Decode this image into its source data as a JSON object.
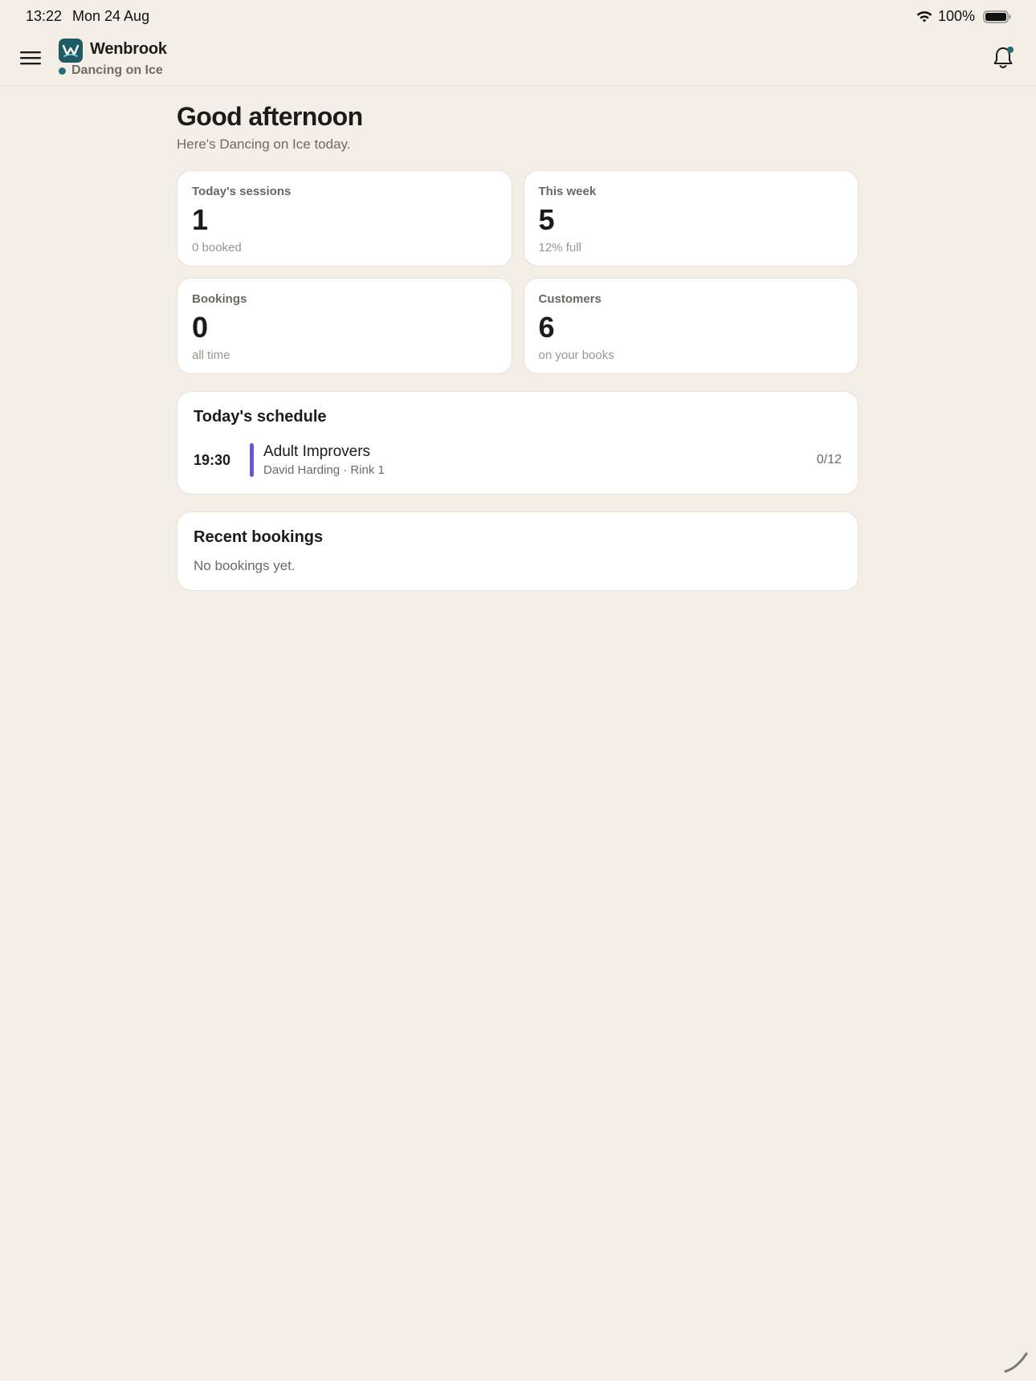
{
  "status_bar": {
    "time": "13:22",
    "date": "Mon 24 Aug",
    "battery": "100%"
  },
  "header": {
    "brand": "Wenbrook",
    "venue": "Dancing on Ice"
  },
  "greeting": {
    "title": "Good afternoon",
    "subtitle": "Here's Dancing on Ice today."
  },
  "stats": [
    {
      "label": "Today's sessions",
      "value": "1",
      "note": "0 booked"
    },
    {
      "label": "This week",
      "value": "5",
      "note": "12% full"
    },
    {
      "label": "Bookings",
      "value": "0",
      "note": "all time"
    },
    {
      "label": "Customers",
      "value": "6",
      "note": "on your books"
    }
  ],
  "schedule": {
    "title": "Today's schedule",
    "sessions": [
      {
        "time": "19:30",
        "name": "Adult Improvers",
        "meta": "David Harding · Rink 1",
        "capacity": "0/12",
        "color": "#6a56d8"
      }
    ]
  },
  "recent": {
    "title": "Recent bookings",
    "empty": "No bookings yet."
  },
  "colors": {
    "background": "#F3EFE6",
    "brand": "#1f5b63",
    "accent": "#1f6f78"
  }
}
